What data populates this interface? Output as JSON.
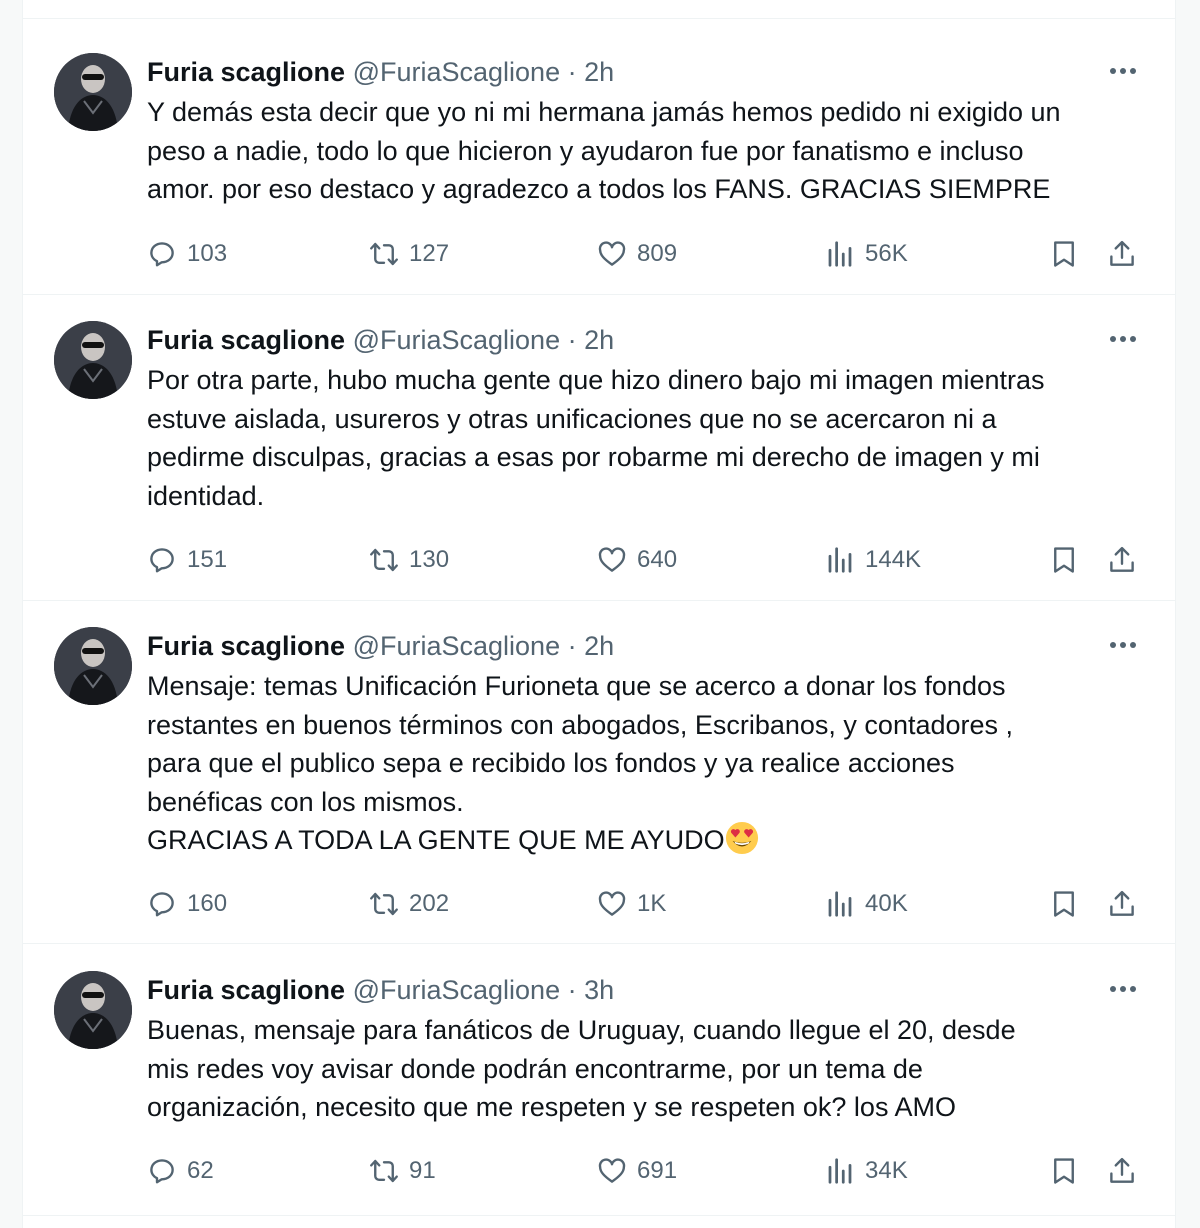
{
  "tweets": [
    {
      "name": "Furia scaglione",
      "handle": "@FuriaScaglione",
      "separator": "·",
      "time": "2h",
      "text": "Y demás esta decir que yo ni mi hermana jamás hemos pedido ni exigido un\npeso a nadie, todo lo que hicieron y ayudaron fue por fanatismo e incluso\namor. por eso destaco y agradezco a todos los FANS. GRACIAS SIEMPRE",
      "emoji": "",
      "replies": "103",
      "retweets": "127",
      "likes": "809",
      "views": "56K"
    },
    {
      "name": "Furia scaglione",
      "handle": "@FuriaScaglione",
      "separator": "·",
      "time": "2h",
      "text": "Por otra parte, hubo mucha gente que hizo dinero bajo mi imagen mientras\nestuve aislada, usureros y otras unificaciones que no se acercaron ni a\npedirme disculpas, gracias a esas por robarme mi derecho de imagen y mi\nidentidad.",
      "emoji": "",
      "replies": "151",
      "retweets": "130",
      "likes": "640",
      "views": "144K"
    },
    {
      "name": "Furia scaglione",
      "handle": "@FuriaScaglione",
      "separator": "·",
      "time": "2h",
      "text": "Mensaje: temas Unificación Furioneta que se acerco a donar los fondos\nrestantes en buenos términos con abogados, Escribanos, y contadores ,\npara que el publico sepa e recibido los fondos y ya realice acciones\nbenéficas con los mismos.\nGRACIAS A TODA LA GENTE QUE ME AYUDO",
      "emoji": "heart-eyes-emoji",
      "replies": "160",
      "retweets": "202",
      "likes": "1K",
      "views": "40K"
    },
    {
      "name": "Furia scaglione",
      "handle": "@FuriaScaglione",
      "separator": "·",
      "time": "3h",
      "text": "Buenas, mensaje para fanáticos de Uruguay, cuando llegue el 20, desde\nmis redes voy avisar donde podrán encontrarme, por un tema de\norganización, necesito que me respeten y se respeten ok? los AMO",
      "emoji": "",
      "replies": "62",
      "retweets": "91",
      "likes": "691",
      "views": "34K"
    }
  ],
  "icons": {
    "more": "more-horizontal-icon",
    "reply": "reply-icon",
    "retweet": "retweet-icon",
    "like": "heart-icon",
    "views": "views-icon",
    "bookmark": "bookmark-icon",
    "share": "share-icon"
  },
  "colors": {
    "text": "#0f1419",
    "secondary": "#536471",
    "border": "#eff3f4"
  }
}
